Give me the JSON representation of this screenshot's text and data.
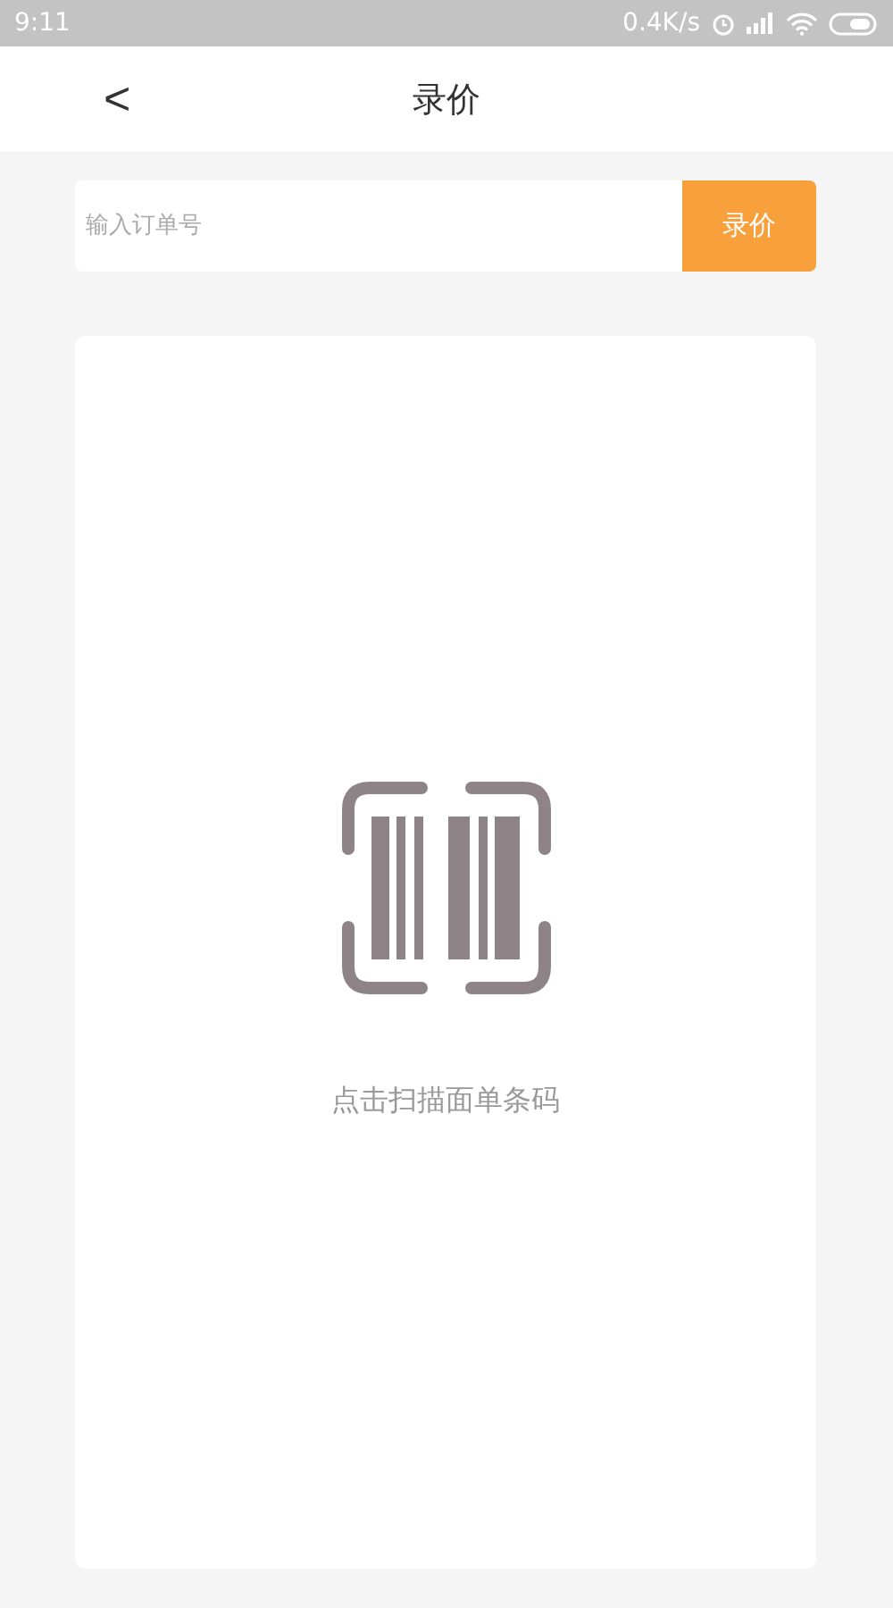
{
  "status_bar": {
    "time": "9:11",
    "speed": "0.4K/s"
  },
  "header": {
    "back": "<",
    "title": "录价"
  },
  "order_input": {
    "placeholder": "输入订单号",
    "button": "录价"
  },
  "scan_card": {
    "hint": "点击扫描面单条码"
  }
}
